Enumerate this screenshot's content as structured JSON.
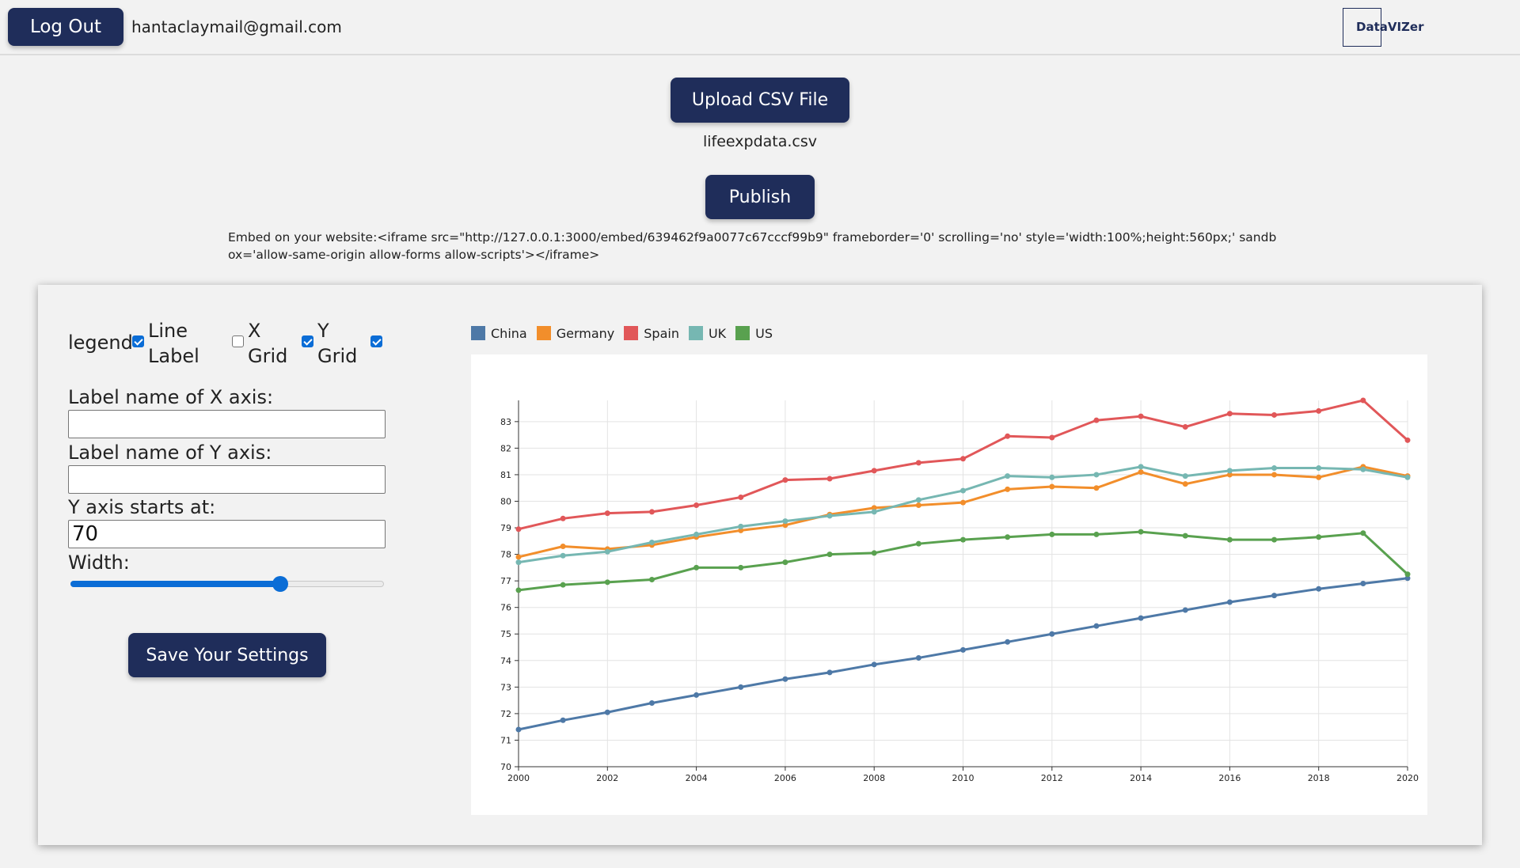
{
  "header": {
    "logout_label": "Log Out",
    "email": "hantaclaymail@gmail.com",
    "logo_text": "DataVIZer"
  },
  "upload": {
    "button_label": "Upload CSV File",
    "filename": "lifeexpdata.csv"
  },
  "publish": {
    "button_label": "Publish",
    "embed_text": "Embed on your website:<iframe src=\"http://127.0.0.1:3000/embed/639462f9a0077c67cccf99b9\" frameborder='0' scrolling='no' style='width:100%;height:560px;' sandbox='allow-same-origin allow-forms allow-scripts'></iframe>"
  },
  "settings": {
    "legend_label": "legend",
    "legend_checked": true,
    "line_label_line1": "Line",
    "line_label_line2": "Label",
    "line_label_checked": false,
    "x_grid_line1": "X",
    "x_grid_line2": "Grid",
    "x_grid_checked": true,
    "y_grid_line1": "Y",
    "y_grid_line2": "Grid",
    "y_grid_checked": true,
    "x_axis_label": "Label name of X axis:",
    "x_axis_value": "",
    "y_axis_label": "Label name of Y axis:",
    "y_axis_value": "",
    "y_start_label": "Y axis starts at:",
    "y_start_value": "70",
    "width_label": "Width:",
    "width_value_fraction": 0.67,
    "save_label": "Save Your Settings",
    "accent_color": "#0b6dd6",
    "button_color": "#1f2d5a"
  },
  "chart_data": {
    "type": "line",
    "title": "",
    "xlabel": "",
    "ylabel": "",
    "x": [
      2000,
      2001,
      2002,
      2003,
      2004,
      2005,
      2006,
      2007,
      2008,
      2009,
      2010,
      2011,
      2012,
      2013,
      2014,
      2015,
      2016,
      2017,
      2018,
      2019,
      2020
    ],
    "xlim": [
      2000,
      2020
    ],
    "ylim": [
      70,
      83.8
    ],
    "x_ticks": [
      2000,
      2002,
      2004,
      2006,
      2008,
      2010,
      2012,
      2014,
      2016,
      2018,
      2020
    ],
    "y_ticks": [
      70,
      71,
      72,
      73,
      74,
      75,
      76,
      77,
      78,
      79,
      80,
      81,
      82,
      83
    ],
    "grid": true,
    "legend": "top-left",
    "series": [
      {
        "name": "China",
        "color": "#4e79a7",
        "values": [
          71.4,
          71.75,
          72.05,
          72.4,
          72.7,
          73.0,
          73.3,
          73.55,
          73.85,
          74.1,
          74.4,
          74.7,
          75.0,
          75.3,
          75.6,
          75.9,
          76.2,
          76.45,
          76.7,
          76.9,
          77.1
        ]
      },
      {
        "name": "Germany",
        "color": "#f28e2b",
        "values": [
          77.9,
          78.3,
          78.2,
          78.35,
          78.65,
          78.9,
          79.1,
          79.5,
          79.75,
          79.85,
          79.95,
          80.45,
          80.55,
          80.5,
          81.1,
          80.65,
          81.0,
          81.0,
          80.9,
          81.3,
          80.95
        ]
      },
      {
        "name": "Spain",
        "color": "#e15759",
        "values": [
          78.95,
          79.35,
          79.55,
          79.6,
          79.85,
          80.15,
          80.8,
          80.85,
          81.15,
          81.45,
          81.6,
          82.45,
          82.4,
          83.05,
          83.2,
          82.8,
          83.3,
          83.25,
          83.4,
          83.8,
          82.3
        ]
      },
      {
        "name": "UK",
        "color": "#76b7b2",
        "values": [
          77.7,
          77.95,
          78.1,
          78.45,
          78.75,
          79.05,
          79.25,
          79.45,
          79.6,
          80.05,
          80.4,
          80.95,
          80.9,
          81.0,
          81.3,
          80.95,
          81.15,
          81.25,
          81.25,
          81.2,
          80.9
        ]
      },
      {
        "name": "US",
        "color": "#59a14f",
        "values": [
          76.65,
          76.85,
          76.95,
          77.05,
          77.5,
          77.5,
          77.7,
          78.0,
          78.05,
          78.4,
          78.55,
          78.65,
          78.75,
          78.75,
          78.85,
          78.7,
          78.55,
          78.55,
          78.65,
          78.8,
          77.25
        ]
      }
    ]
  }
}
